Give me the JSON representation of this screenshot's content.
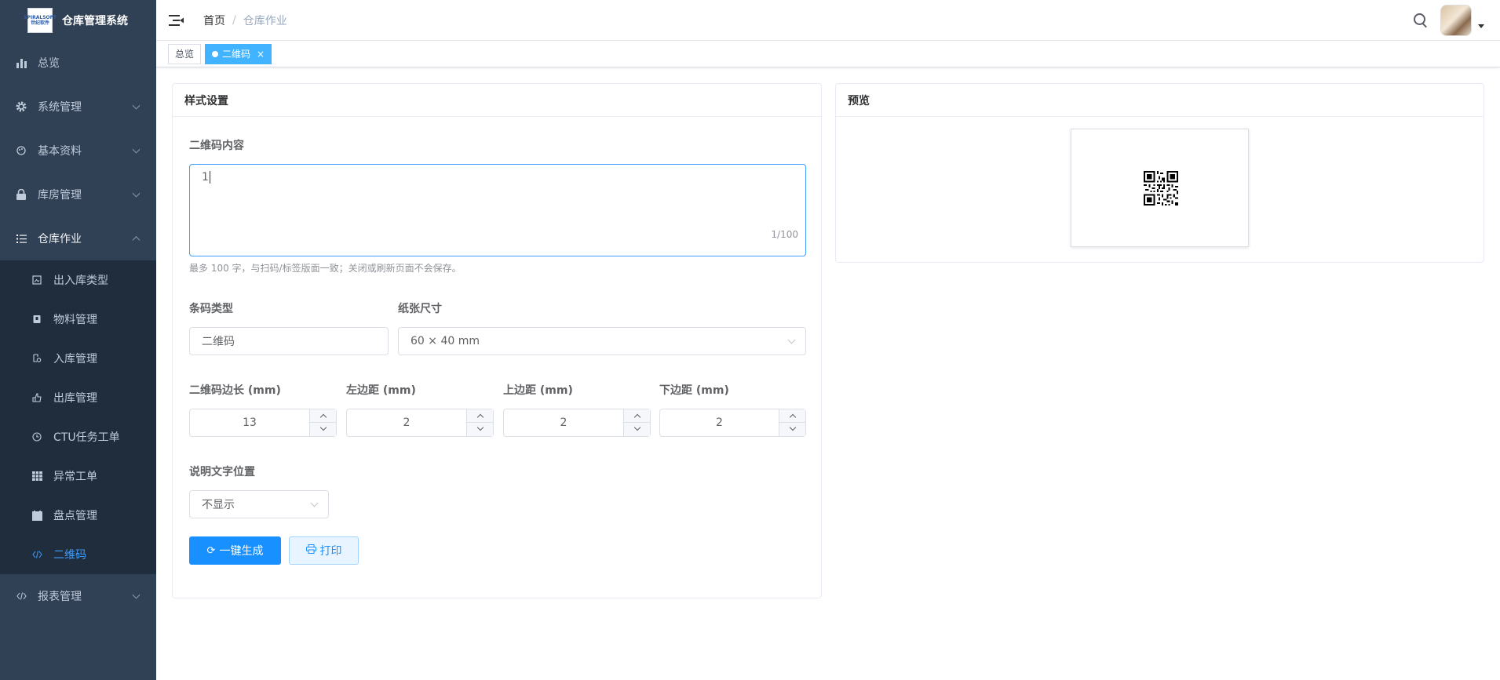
{
  "app": {
    "title": "仓库管理系统",
    "logo_text": "SPIRALSOFT 世纪软件"
  },
  "sidebar": {
    "items": [
      {
        "label": "总览",
        "icon": "bar-chart-icon"
      },
      {
        "label": "系统管理",
        "icon": "gear-icon"
      },
      {
        "label": "基本资料",
        "icon": "palette-icon"
      },
      {
        "label": "库房管理",
        "icon": "lock-icon"
      },
      {
        "label": "仓库作业",
        "icon": "list-icon"
      }
    ],
    "sub_items": [
      {
        "label": "出入库类型",
        "icon": "picture-icon"
      },
      {
        "label": "物料管理",
        "icon": "box-icon"
      },
      {
        "label": "入库管理",
        "icon": "inbound-icon"
      },
      {
        "label": "出库管理",
        "icon": "outbound-icon"
      },
      {
        "label": "CTU任务工单",
        "icon": "clock-icon"
      },
      {
        "label": "异常工单",
        "icon": "grid-icon"
      },
      {
        "label": "盘点管理",
        "icon": "clipboard-icon"
      },
      {
        "label": "二维码",
        "icon": "code-icon"
      }
    ],
    "last_item": {
      "label": "报表管理",
      "icon": "code-icon"
    }
  },
  "navbar": {
    "breadcrumb_home": "首页",
    "breadcrumb_sep": "/",
    "breadcrumb_current": "仓库作业"
  },
  "tags": {
    "overview": "总览",
    "current": "二维码",
    "close": "×"
  },
  "style_card": {
    "title": "样式设置",
    "content_label": "二维码内容",
    "content_value": "1",
    "counter": "1/100",
    "hint": "最多 100 字，与扫码/标签版面一致；关闭或刷新页面不会保存。",
    "barcode_type_label": "条码类型",
    "barcode_type_value": "二维码",
    "paper_size_label": "纸张尺寸",
    "paper_size_value": "60 × 40 mm",
    "qr_size_label": "二维码边长 (mm)",
    "qr_size_value": "13",
    "left_margin_label": "左边距 (mm)",
    "left_margin_value": "2",
    "top_margin_label": "上边距 (mm)",
    "top_margin_value": "2",
    "bottom_margin_label": "下边距 (mm)",
    "bottom_margin_value": "2",
    "caption_pos_label": "说明文字位置",
    "caption_pos_value": "不显示",
    "generate_button": "一键生成",
    "print_button": "打印"
  },
  "preview_card": {
    "title": "预览"
  },
  "colors": {
    "sidebar_bg": "#304156",
    "submenu_bg": "#1f2d3d",
    "primary": "#1890ff",
    "active_menu": "#409eff"
  }
}
